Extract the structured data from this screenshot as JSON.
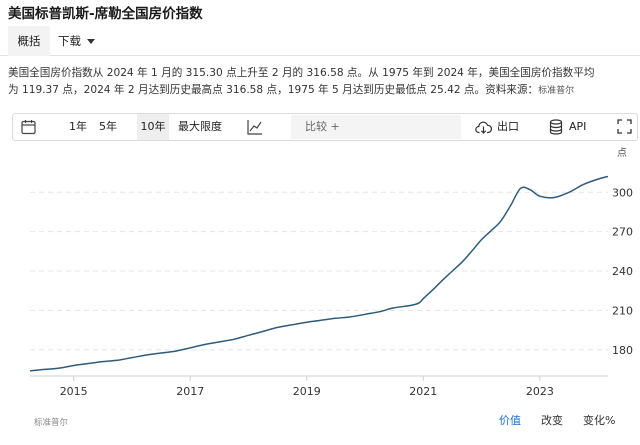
{
  "title": "美国标普凯斯-席勒全国房价指数",
  "tabs": [
    {
      "label": "概括",
      "active": true
    },
    {
      "label": "下载",
      "active": false
    }
  ],
  "description": {
    "line1": "美国全国房价指数从 2024 年 1 月的 315.30 点上升至 2 月的 316.58 点。从 1975 年到 2024 年，美国全国房价指数平均",
    "line2": "为 119.37 点，2024 年 2 月达到历史最高点 316.58 点，1975 年 5 月达到历史最低点 25.42 点。资料来源：",
    "source": "标准普尔"
  },
  "toolbar": {
    "ranges": [
      "1年",
      "5年",
      "10年",
      "最大限度"
    ],
    "selected_range": "10年",
    "compare_placeholder": "比较 +",
    "export_label": "出口",
    "api_label": "API"
  },
  "icons": [
    "calendar-icon",
    "line-chart-icon",
    "export-icon",
    "database-icon",
    "fullscreen-icon"
  ],
  "footer": {
    "source": "标准普尔",
    "modes": [
      "价值",
      "改变",
      "变化%"
    ],
    "active_mode": "价值"
  },
  "colors": {
    "line": "#2f5b7a",
    "accent": "#1a73c7"
  },
  "chart_data": {
    "type": "line",
    "unit_label": "点",
    "x_ticks": [
      "2015",
      "2017",
      "2019",
      "2021",
      "2023"
    ],
    "y_ticks": [
      180,
      210,
      240,
      270,
      300
    ],
    "ylim": [
      160,
      320
    ],
    "xlim": [
      2014.25,
      2024.17
    ],
    "grid": "horizontal dashed",
    "series": [
      {
        "name": "",
        "points": [
          [
            2014.25,
            164
          ],
          [
            2014.5,
            165
          ],
          [
            2014.75,
            166
          ],
          [
            2015.0,
            168
          ],
          [
            2015.25,
            169.5
          ],
          [
            2015.5,
            171
          ],
          [
            2015.75,
            172
          ],
          [
            2016.0,
            174
          ],
          [
            2016.25,
            176
          ],
          [
            2016.5,
            177.5
          ],
          [
            2016.75,
            179
          ],
          [
            2017.0,
            181.5
          ],
          [
            2017.25,
            184
          ],
          [
            2017.5,
            186
          ],
          [
            2017.75,
            188
          ],
          [
            2018.0,
            191
          ],
          [
            2018.25,
            194
          ],
          [
            2018.5,
            197
          ],
          [
            2018.75,
            199
          ],
          [
            2019.0,
            201
          ],
          [
            2019.25,
            202.5
          ],
          [
            2019.5,
            204
          ],
          [
            2019.75,
            205
          ],
          [
            2020.0,
            207
          ],
          [
            2020.25,
            209
          ],
          [
            2020.5,
            212
          ],
          [
            2020.75,
            213.5
          ],
          [
            2020.92,
            215.5
          ],
          [
            2021.0,
            219
          ],
          [
            2021.17,
            226
          ],
          [
            2021.33,
            233
          ],
          [
            2021.5,
            240
          ],
          [
            2021.67,
            247
          ],
          [
            2021.83,
            255
          ],
          [
            2022.0,
            264
          ],
          [
            2022.17,
            271
          ],
          [
            2022.33,
            278
          ],
          [
            2022.5,
            290
          ],
          [
            2022.67,
            303
          ],
          [
            2022.83,
            302
          ],
          [
            2023.0,
            297
          ],
          [
            2023.25,
            296
          ],
          [
            2023.5,
            300
          ],
          [
            2023.75,
            306
          ],
          [
            2024.0,
            310
          ],
          [
            2024.17,
            312
          ]
        ]
      }
    ]
  }
}
